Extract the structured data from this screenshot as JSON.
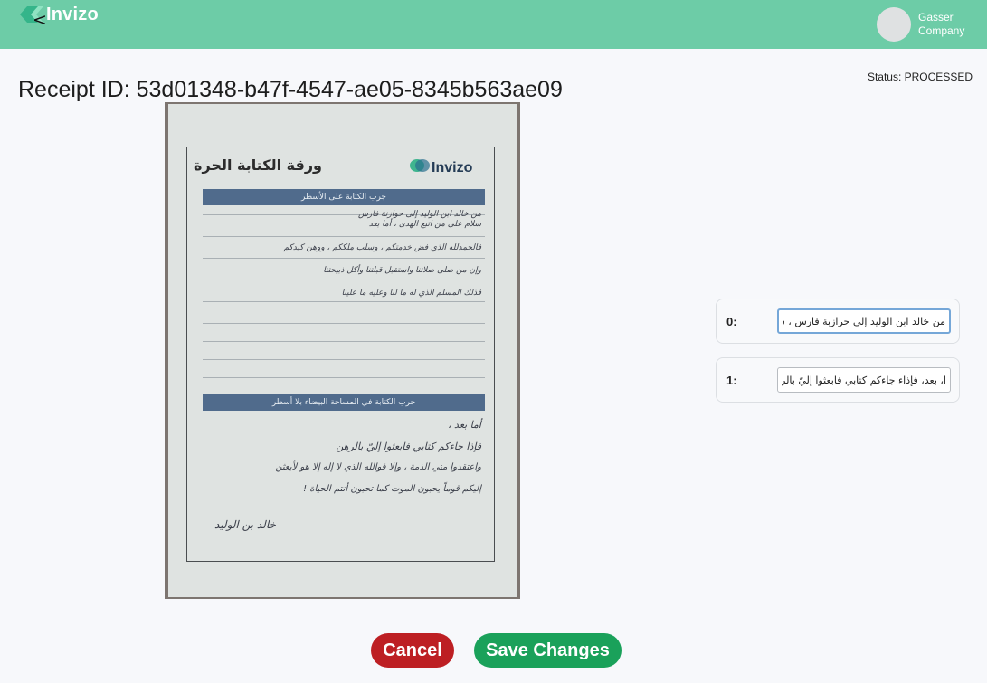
{
  "header": {
    "brand": "Invizo",
    "back_glyph": "<",
    "user": {
      "name": "Gasser Company"
    },
    "colors": {
      "bar": "#6dcca7",
      "logo_mark": "#35b58a"
    }
  },
  "receipt": {
    "title": "Receipt ID: 53d01348-b47f-4547-ae05-8345b563ae09",
    "status": "Status: PROCESSED"
  },
  "scan": {
    "form_title": "ورقة الكتابة الحرة",
    "brand": "Invizo",
    "band_lines": "جرب الكتابة على الأسطر",
    "band_blank": "جرب الكتابة في المساحة البيضاء بلا أسطر",
    "lines_part1": [
      "من خالد ابن الوليد إلى حوازنة فارس",
      "سلام على من اتبع الهدى ، أما بعد",
      "فالحمدلله الذي فض خدمتكم ، وسلب ملككم ، ووهن كيدكم",
      "وإن من صلى صلاتنا واستقبل قبلتنا وأكل ذبيحتنا",
      "فذلك المسلم الذي له ما لنا وعليه ما علينا"
    ],
    "lines_part2": [
      "أما بعد ،",
      "فإذا جاءكم كتابي فابعثوا إليّ بالرهن",
      "واعتقدوا مني الذمة ، وإلا فوالله الذي لا إله إلا هو لأبعثن",
      "إليكم قوماً يحبون الموت كما تحبون أنتم الحياة !",
      "خالد بن الوليد"
    ]
  },
  "fields": [
    {
      "label": "0:",
      "value": "من خالد ابن الوليد إلى حرازبة فارس ، ش"
    },
    {
      "label": "1:",
      "value": "أ، بعد، فإذاء جاءكم كتابي فابعثوا إليّ بالر"
    }
  ],
  "actions": {
    "cancel_label": "Cancel",
    "save_label": "Save Changes",
    "colors": {
      "cancel": "#bd1f23",
      "save": "#1aa15a"
    }
  }
}
